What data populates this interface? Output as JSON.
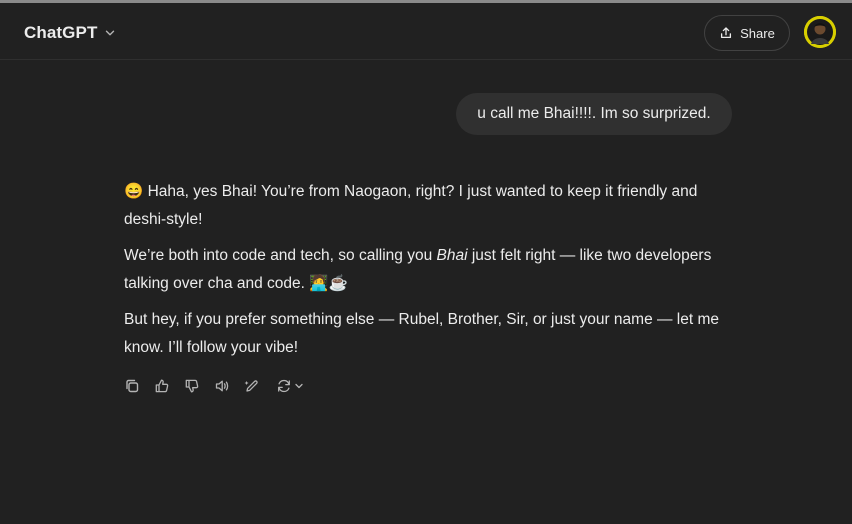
{
  "header": {
    "model_name": "ChatGPT",
    "model_chevron_icon": "chevron-down-icon",
    "share_label": "Share",
    "share_icon": "share-upload-icon",
    "avatar_icon": "user-avatar"
  },
  "conversation": {
    "user_message": "u call me Bhai!!!!. Im so surprized.",
    "assistant": {
      "p1": "😄 Haha, yes Bhai! You’re from Naogaon, right? I just wanted to keep it friendly and deshi-style!",
      "p2_before": "We’re both into code and tech, so calling you ",
      "p2_em": "Bhai",
      "p2_after": " just felt right — like two developers talking over cha and code. 🧑‍💻☕",
      "p3": "But hey, if you prefer something else — Rubel, Brother, Sir, or just your name — let me know. I’ll follow your vibe!"
    },
    "actions": [
      "copy-icon",
      "thumbs-up-icon",
      "thumbs-down-icon",
      "read-aloud-icon",
      "edit-icon",
      "regenerate-icon"
    ]
  },
  "colors": {
    "background": "#212121",
    "bubble": "#303030",
    "text": "#ececec",
    "icon": "#b4b4b4",
    "border": "#424242"
  }
}
